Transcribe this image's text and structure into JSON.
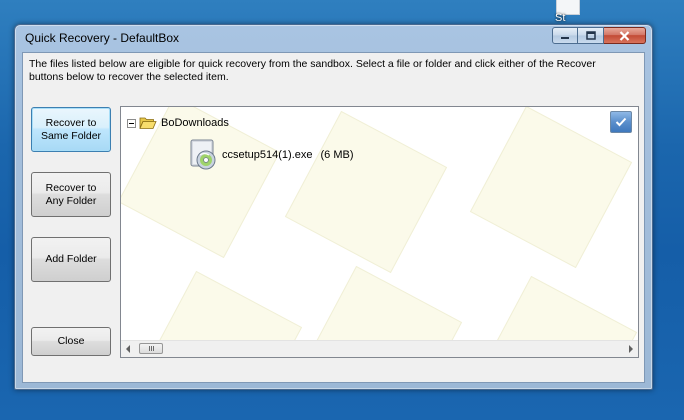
{
  "desktop": {
    "icon_label": "St"
  },
  "window": {
    "title": "Quick Recovery - DefaultBox",
    "caption_buttons": [
      "minimize",
      "maximize",
      "close"
    ]
  },
  "description": "The files listed below are eligible for quick recovery from the sandbox.  Select a file or folder and click either of the Recover buttons below to recover the selected item.",
  "buttons": {
    "recover_same": "Recover to Same Folder",
    "recover_any": "Recover to Any Folder",
    "add_folder": "Add Folder",
    "close": "Close"
  },
  "tree": {
    "folder": {
      "name": "BoDownloads",
      "expanded": true,
      "icon": "folder-open-icon"
    },
    "items": [
      {
        "name": "ccsetup514(1).exe",
        "size": "(6 MB)",
        "icon": "installer-cd-icon"
      }
    ]
  },
  "colors": {
    "desktop_blue": "#1b66ad",
    "window_frame": "#a4bfdc",
    "focused_button": "#bee6fd",
    "tile_fill": "#fbfaea"
  }
}
